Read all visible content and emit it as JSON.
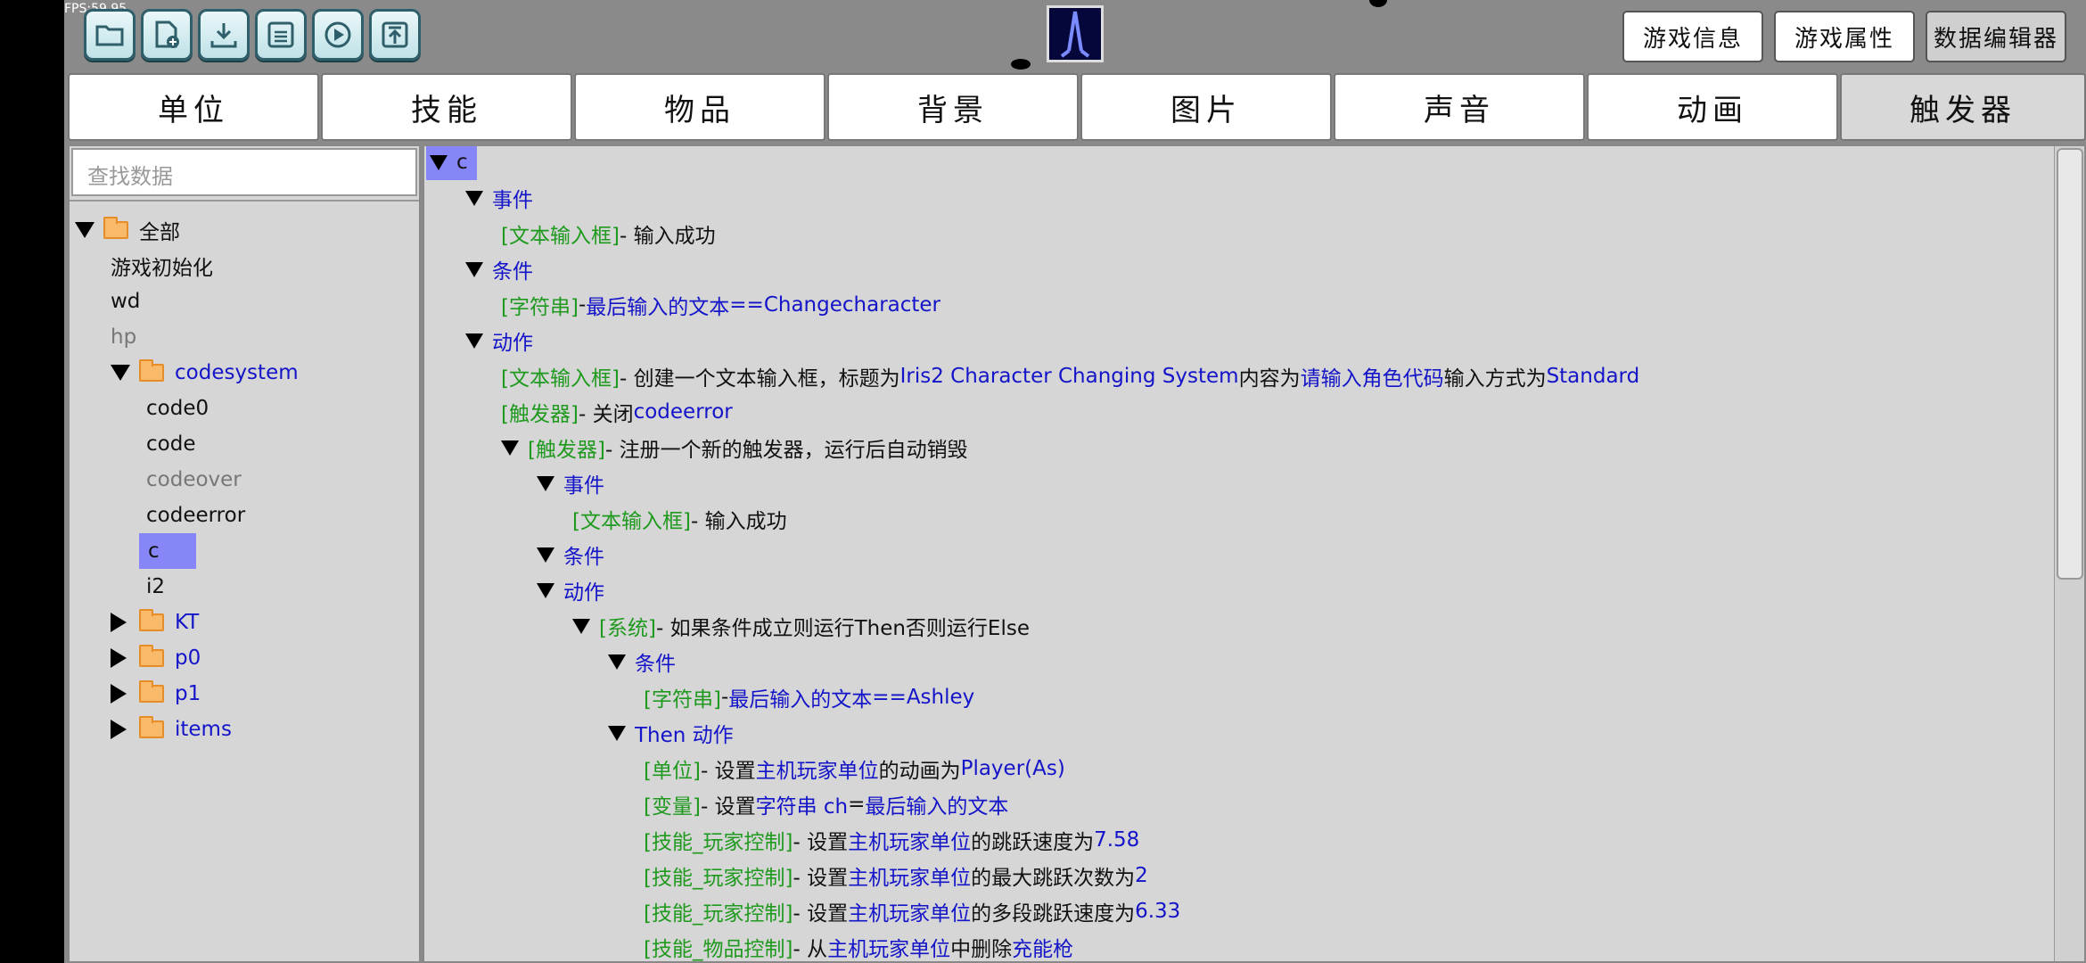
{
  "fps": "FPS:59.95",
  "top_buttons": {
    "game_info": "游戏信息",
    "game_props": "游戏属性",
    "data_editor": "数据编辑器"
  },
  "tabs": [
    "单位",
    "技能",
    "物品",
    "背景",
    "图片",
    "声音",
    "动画",
    "触发器"
  ],
  "search": {
    "placeholder": "查找数据"
  },
  "tree": {
    "all": "全部",
    "game_init": "游戏初始化",
    "wd": "wd",
    "hp": "hp",
    "codesystem": "codesystem",
    "code0": "code0",
    "code": "code",
    "codeover": "codeover",
    "codeerror": "codeerror",
    "c": "c",
    "i2": "i2",
    "kt": "KT",
    "p0": "p0",
    "p1": "p1",
    "items": "items"
  },
  "editor": {
    "root": "c",
    "event": "事件",
    "condition": "条件",
    "action": "动作",
    "l1_tag": "[文本输入框]",
    "l1_text": " - 输入成功",
    "l2_tag": "[字符串]",
    "l2_sep": " - ",
    "l2_var": "最后输入的文本",
    "l2_op": " == ",
    "l2_val": "Changecharacter",
    "l3_tag": "[文本输入框]",
    "l3_a": " - 创建一个文本输入框，标题为 ",
    "l3_title": "Iris2 Character Changing System",
    "l3_b": " 内容为 ",
    "l3_content": "请输入角色代码",
    "l3_c": " 输入方式为 ",
    "l3_mode": "Standard",
    "l4_tag": "[触发器]",
    "l4_text": " - 关闭 ",
    "l4_name": "codeerror",
    "l5_tag": "[触发器]",
    "l5_text": " - 注册一个新的触发器，运行后自动销毁",
    "l6_tag": "[文本输入框]",
    "l6_text": " - 输入成功",
    "l7_tag": "[系统]",
    "l7_text": " - 如果条件成立则运行Then否则运行Else",
    "l8_tag": "[字符串]",
    "l8_sep": " - ",
    "l8_var": "最后输入的文本",
    "l8_op": " == ",
    "l8_val": "Ashley",
    "then_action": "Then 动作",
    "l9_tag": "[单位]",
    "l9_a": " - 设置 ",
    "l9_unit": "主机玩家单位",
    "l9_b": " 的动画为 ",
    "l9_val": "Player(As)",
    "l10_tag": "[变量]",
    "l10_a": " - 设置 ",
    "l10_var": "字符串 ch",
    "l10_op": " = ",
    "l10_val": "最后输入的文本",
    "l11_tag": "[技能_玩家控制]",
    "l11_a": " - 设置 ",
    "l11_unit": "主机玩家单位",
    "l11_b": " 的跳跃速度为 ",
    "l11_val": "7.58",
    "l12_tag": "[技能_玩家控制]",
    "l12_a": " - 设置 ",
    "l12_unit": "主机玩家单位",
    "l12_b": " 的最大跳跃次数为 ",
    "l12_val": "2",
    "l13_tag": "[技能_玩家控制]",
    "l13_a": " - 设置 ",
    "l13_unit": "主机玩家单位",
    "l13_b": " 的多段跳跃速度为 ",
    "l13_val": "6.33",
    "l14_tag": "[技能_物品控制]",
    "l14_a": " - 从 ",
    "l14_unit": "主机玩家单位",
    "l14_b": " 中删除 ",
    "l14_val": "充能枪"
  },
  "colors": {
    "keyword_blue": "#1414c8",
    "tag_green": "#1f9a1f",
    "selection": "#8686f8"
  }
}
